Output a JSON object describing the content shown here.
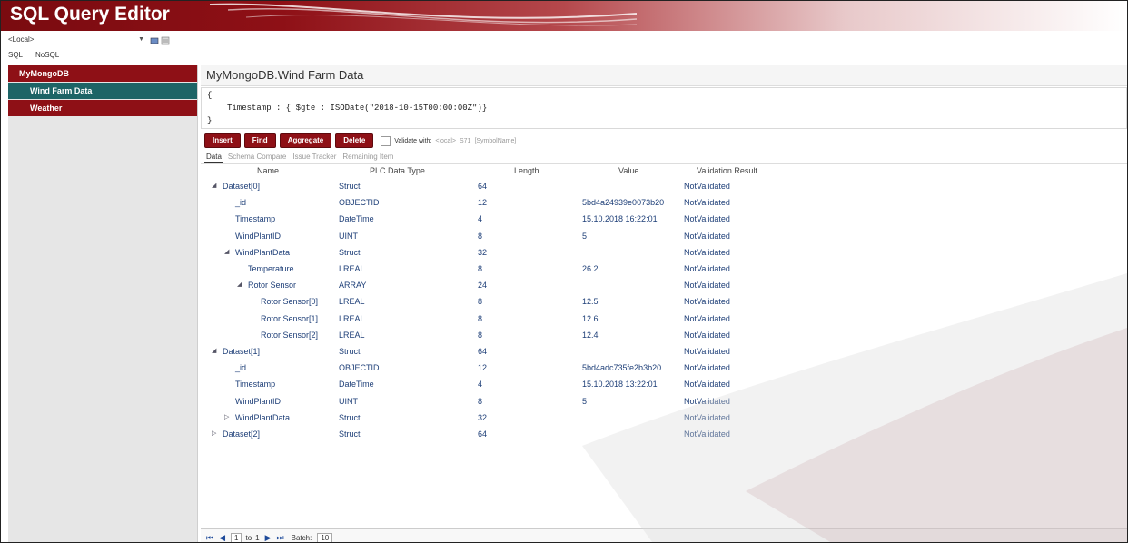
{
  "app": {
    "title": "SQL Query Editor"
  },
  "connection": {
    "server": "<Local>"
  },
  "mode_tabs": [
    "SQL",
    "NoSQL"
  ],
  "sidebar": {
    "database": "MyMongoDB",
    "collections": [
      {
        "label": "Wind Farm Data",
        "selected": true
      },
      {
        "label": "Weather",
        "selected": false
      }
    ]
  },
  "main": {
    "collection_title": "MyMongoDB.Wind Farm Data",
    "query": {
      "open": "{",
      "body": "Timestamp : { $gte : ISODate(\"2018-10-15T00:00:00Z\")}",
      "close": "}"
    },
    "toolbar": {
      "insert": "Insert",
      "find": "Find",
      "aggregate": "Aggregate",
      "delete": "Delete",
      "validate_label": "Validate with:",
      "validate_server": "<local>",
      "validate_s7": "S71",
      "validate_symbol": "[SymbolName]"
    },
    "tabs": [
      "Data",
      "Schema Compare",
      "Issue Tracker",
      "Remaining Item"
    ],
    "columns": [
      "Name",
      "PLC Data Type",
      "Length",
      "Value",
      "Validation Result"
    ],
    "rows": [
      {
        "name": "Dataset[0]",
        "type": "Struct",
        "length": "64",
        "value": "",
        "result": "NotValidated",
        "expander": "◢"
      },
      {
        "name": "_id",
        "type": "OBJECTID",
        "length": "12",
        "value": "5bd4a24939e0073b20",
        "result": "NotValidated",
        "expander": ""
      },
      {
        "name": "Timestamp",
        "type": "DateTime",
        "length": "4",
        "value": "15.10.2018 16:22:01",
        "result": "NotValidated",
        "expander": ""
      },
      {
        "name": "WindPlantID",
        "type": "UINT",
        "length": "8",
        "value": "5",
        "result": "NotValidated",
        "expander": ""
      },
      {
        "name": "WindPlantData",
        "type": "Struct",
        "length": "32",
        "value": "",
        "result": "NotValidated",
        "expander": "◢"
      },
      {
        "name": "Temperature",
        "type": "LREAL",
        "length": "8",
        "value": "26.2",
        "result": "NotValidated",
        "expander": ""
      },
      {
        "name": "Rotor Sensor",
        "type": "ARRAY",
        "length": "24",
        "value": "",
        "result": "NotValidated",
        "expander": "◢"
      },
      {
        "name": "Rotor Sensor[0]",
        "type": "LREAL",
        "length": "8",
        "value": "12.5",
        "result": "NotValidated",
        "expander": ""
      },
      {
        "name": "Rotor Sensor[1]",
        "type": "LREAL",
        "length": "8",
        "value": "12.6",
        "result": "NotValidated",
        "expander": ""
      },
      {
        "name": "Rotor Sensor[2]",
        "type": "LREAL",
        "length": "8",
        "value": "12.4",
        "result": "NotValidated",
        "expander": ""
      },
      {
        "name": "Dataset[1]",
        "type": "Struct",
        "length": "64",
        "value": "",
        "result": "NotValidated",
        "expander": "◢"
      },
      {
        "name": "_id",
        "type": "OBJECTID",
        "length": "12",
        "value": "5bd4adc735fe2b3b20",
        "result": "NotValidated",
        "expander": ""
      },
      {
        "name": "Timestamp",
        "type": "DateTime",
        "length": "4",
        "value": "15.10.2018 13:22:01",
        "result": "NotValidated",
        "expander": ""
      },
      {
        "name": "WindPlantID",
        "type": "UINT",
        "length": "8",
        "value": "5",
        "result": "NotValidated",
        "expander": ""
      },
      {
        "name": "WindPlantData",
        "type": "Struct",
        "length": "32",
        "value": "",
        "result": "NotValidated",
        "expander": "▷"
      },
      {
        "name": "Dataset[2]",
        "type": "Struct",
        "length": "64",
        "value": "",
        "result": "NotValidated",
        "expander": "▷"
      }
    ]
  },
  "pager": {
    "page": "1",
    "to_label": "to",
    "total": "1",
    "batch_label": "Batch:",
    "batch": "10"
  },
  "colors": {
    "accent": "#8e1016",
    "selected": "#1d6466",
    "link": "#1e3f78"
  }
}
